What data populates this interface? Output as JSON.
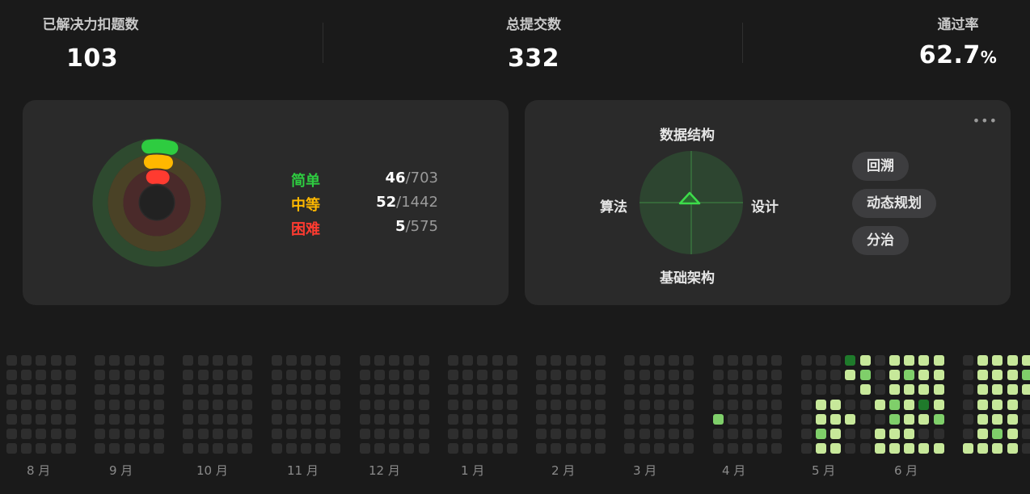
{
  "stats": {
    "solved_label": "已解决力扣题数",
    "solved_value": "103",
    "submissions_label": "总提交数",
    "submissions_value": "332",
    "rate_label": "通过率",
    "rate_value": "62.7",
    "rate_unit": "%"
  },
  "difficulty": [
    {
      "name": "简单",
      "solved": "46",
      "total": "/703",
      "color": "#2ecc40",
      "fraction": 0.065
    },
    {
      "name": "中等",
      "solved": "52",
      "total": "/1442",
      "color": "#ffb800",
      "fraction": 0.036
    },
    {
      "name": "困难",
      "solved": "5",
      "total": "/575",
      "color": "#ff3b30",
      "fraction": 0.009
    }
  ],
  "skills": {
    "top": "数据结构",
    "right": "设计",
    "bottom": "基础架构",
    "left": "算法",
    "more": "•••",
    "tags": [
      "回溯",
      "动态规划",
      "分治"
    ]
  },
  "months": [
    "8 月",
    "9 月",
    "10 月",
    "11 月",
    "12 月",
    "1 月",
    "2 月",
    "3 月",
    "4 月",
    "5 月",
    "6 月"
  ],
  "colors": {
    "background": "#1a1a1a",
    "card": "#2a2a2a",
    "cell_empty": "#2e2e2e",
    "cell_light": "#c7e89a",
    "cell_mid": "#7fcf6a",
    "cell_dark": "#1f7a2b"
  }
}
